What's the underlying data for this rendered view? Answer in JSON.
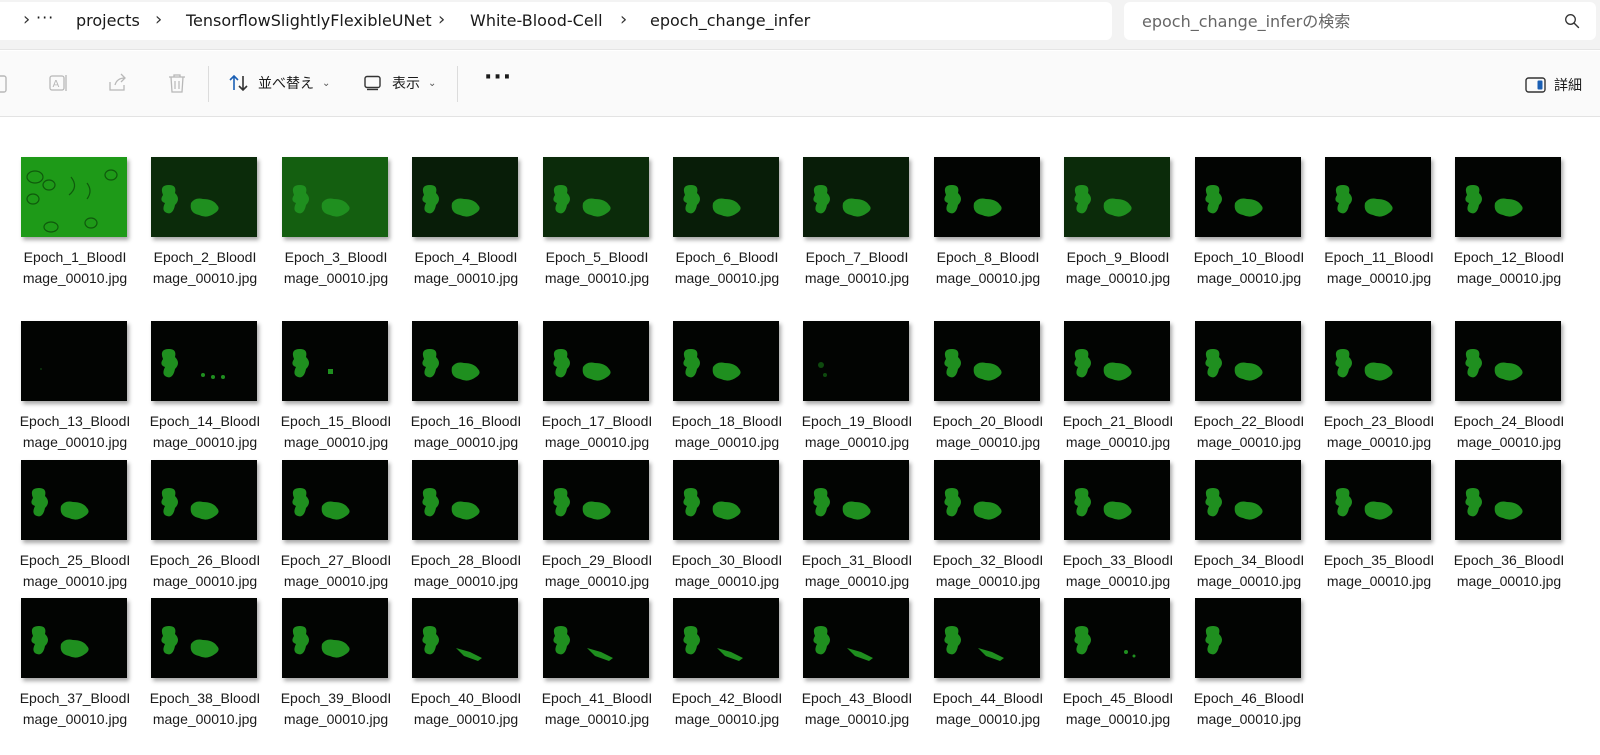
{
  "breadcrumb": {
    "more": "···",
    "segments": [
      "projects",
      "TensorflowSlightlyFlexibleUNet",
      "White-Blood-Cell",
      "epoch_change_infer"
    ]
  },
  "search": {
    "placeholder": "epoch_change_inferの検索"
  },
  "toolbar": {
    "sort_label": "並べ替え",
    "view_label": "表示",
    "more_label": "···",
    "details_label": "詳細"
  },
  "files": [
    {
      "line1": "Epoch_1_BloodI",
      "line2": "mage_00010.jpg"
    },
    {
      "line1": "Epoch_2_BloodI",
      "line2": "mage_00010.jpg"
    },
    {
      "line1": "Epoch_3_BloodI",
      "line2": "mage_00010.jpg"
    },
    {
      "line1": "Epoch_4_BloodI",
      "line2": "mage_00010.jpg"
    },
    {
      "line1": "Epoch_5_BloodI",
      "line2": "mage_00010.jpg"
    },
    {
      "line1": "Epoch_6_BloodI",
      "line2": "mage_00010.jpg"
    },
    {
      "line1": "Epoch_7_BloodI",
      "line2": "mage_00010.jpg"
    },
    {
      "line1": "Epoch_8_BloodI",
      "line2": "mage_00010.jpg"
    },
    {
      "line1": "Epoch_9_BloodI",
      "line2": "mage_00010.jpg"
    },
    {
      "line1": "Epoch_10_BloodI",
      "line2": "mage_00010.jpg"
    },
    {
      "line1": "Epoch_11_BloodI",
      "line2": "mage_00010.jpg"
    },
    {
      "line1": "Epoch_12_BloodI",
      "line2": "mage_00010.jpg"
    },
    {
      "line1": "Epoch_13_BloodI",
      "line2": "mage_00010.jpg"
    },
    {
      "line1": "Epoch_14_BloodI",
      "line2": "mage_00010.jpg"
    },
    {
      "line1": "Epoch_15_BloodI",
      "line2": "mage_00010.jpg"
    },
    {
      "line1": "Epoch_16_BloodI",
      "line2": "mage_00010.jpg"
    },
    {
      "line1": "Epoch_17_BloodI",
      "line2": "mage_00010.jpg"
    },
    {
      "line1": "Epoch_18_BloodI",
      "line2": "mage_00010.jpg"
    },
    {
      "line1": "Epoch_19_BloodI",
      "line2": "mage_00010.jpg"
    },
    {
      "line1": "Epoch_20_BloodI",
      "line2": "mage_00010.jpg"
    },
    {
      "line1": "Epoch_21_BloodI",
      "line2": "mage_00010.jpg"
    },
    {
      "line1": "Epoch_22_BloodI",
      "line2": "mage_00010.jpg"
    },
    {
      "line1": "Epoch_23_BloodI",
      "line2": "mage_00010.jpg"
    },
    {
      "line1": "Epoch_24_BloodI",
      "line2": "mage_00010.jpg"
    },
    {
      "line1": "Epoch_25_BloodI",
      "line2": "mage_00010.jpg"
    },
    {
      "line1": "Epoch_26_BloodI",
      "line2": "mage_00010.jpg"
    },
    {
      "line1": "Epoch_27_BloodI",
      "line2": "mage_00010.jpg"
    },
    {
      "line1": "Epoch_28_BloodI",
      "line2": "mage_00010.jpg"
    },
    {
      "line1": "Epoch_29_BloodI",
      "line2": "mage_00010.jpg"
    },
    {
      "line1": "Epoch_30_BloodI",
      "line2": "mage_00010.jpg"
    },
    {
      "line1": "Epoch_31_BloodI",
      "line2": "mage_00010.jpg"
    },
    {
      "line1": "Epoch_32_BloodI",
      "line2": "mage_00010.jpg"
    },
    {
      "line1": "Epoch_33_BloodI",
      "line2": "mage_00010.jpg"
    },
    {
      "line1": "Epoch_34_BloodI",
      "line2": "mage_00010.jpg"
    },
    {
      "line1": "Epoch_35_BloodI",
      "line2": "mage_00010.jpg"
    },
    {
      "line1": "Epoch_36_BloodI",
      "line2": "mage_00010.jpg"
    },
    {
      "line1": "Epoch_37_BloodI",
      "line2": "mage_00010.jpg"
    },
    {
      "line1": "Epoch_38_BloodI",
      "line2": "mage_00010.jpg"
    },
    {
      "line1": "Epoch_39_BloodI",
      "line2": "mage_00010.jpg"
    },
    {
      "line1": "Epoch_40_BloodI",
      "line2": "mage_00010.jpg"
    },
    {
      "line1": "Epoch_41_BloodI",
      "line2": "mage_00010.jpg"
    },
    {
      "line1": "Epoch_42_BloodI",
      "line2": "mage_00010.jpg"
    },
    {
      "line1": "Epoch_43_BloodI",
      "line2": "mage_00010.jpg"
    },
    {
      "line1": "Epoch_44_BloodI",
      "line2": "mage_00010.jpg"
    },
    {
      "line1": "Epoch_45_BloodI",
      "line2": "mage_00010.jpg"
    },
    {
      "line1": "Epoch_46_BloodI",
      "line2": "mage_00010.jpg"
    }
  ],
  "colors": {
    "thumb_background": "#020402",
    "cell_green": "#1f8f1f",
    "epoch1_background": "#1f9a1a"
  }
}
